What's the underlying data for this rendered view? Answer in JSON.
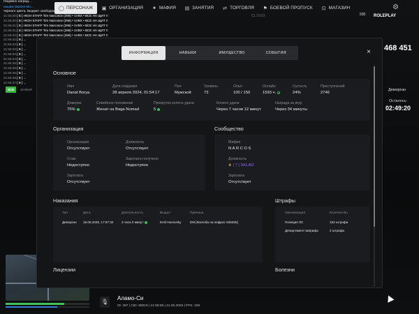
{
  "chat": {
    "header_line": "Недавно наград...",
    "highlight_line": "нашим Wanzet Mo...",
    "line3": "черного цвета. Бюджет свободный.",
    "messages": [
      {
        "time": "21:56:30",
        "text": "[ B ] HIGH STAFF Tim Narcosov (296) • 1VBX • ВСЕ НА ЩИТ !!"
      },
      {
        "time": "21:56:30",
        "text": "[ B ] HIGH STAFF Tim Narcosov (296) • 1VBX • ВСЕ НА ЩИТ !!"
      },
      {
        "time": "21:56:31",
        "text": "[ B ] HIGH STAFF Tim Narcosov (296) • 1VBX • ВСЕ НА ЩИТ !!"
      },
      {
        "time": "21:56:31",
        "text": "[ B ] HIGH STAFF Tim Narcosov (296) • 1VBX • ВСЕ НА ЩИТ !!"
      },
      {
        "time": "21:56:32",
        "text": "[ B ] HIGH STAFF Tim Narcosov (296) • 1VBX • ВСЕ НА ЩИТ !!"
      },
      {
        "time": "21:56:32",
        "text": "[ B ] ..."
      },
      {
        "time": "21:56:33",
        "text": "[ B ] ..."
      },
      {
        "time": "21:56:33",
        "text": "[ B ] ..."
      },
      {
        "time": "21:56:34",
        "text": "[ B ] ..."
      },
      {
        "time": "21:56:34",
        "text": "[ B ] ..."
      },
      {
        "time": "21:56:35",
        "text": "[ B ] ..."
      },
      {
        "time": "21:56:35",
        "text": "[ B ] ..."
      },
      {
        "time": "21:56:36",
        "text": "[ B ] ..."
      },
      {
        "time": "21:56:36",
        "text": "[ B ] ..."
      },
      {
        "time": "21:56:37",
        "text": "[ B ] ..."
      }
    ],
    "chip_all": "ВСЕ",
    "chip_other": "МАФИЯ"
  },
  "nav": {
    "items": [
      {
        "label": "ПЕРСОНАЖ",
        "icon": "person-icon",
        "active": true
      },
      {
        "label": "ОРГАНИЗАЦИЯ",
        "icon": "org-icon"
      },
      {
        "label": "МАФИЯ",
        "icon": "mafia-icon"
      },
      {
        "label": "ЗАНЯТИЯ",
        "icon": "tasks-icon"
      },
      {
        "label": "ТОРГОВЛЯ",
        "icon": "trade-icon"
      },
      {
        "label": "БОЕВОЙ ПРОПУСК",
        "icon": "battlepass-icon"
      },
      {
        "label": "МАГАЗИН",
        "icon": "shop-icon"
      }
    ]
  },
  "hud": {
    "cloud": "CLOUD",
    "badge": "530",
    "roleplay": "ROLEPLAY",
    "cash": "468 451",
    "demorgan": "Деморган",
    "remaining_label": "Осталось:",
    "timer": "02:49:20",
    "location": "Аламо-Си",
    "status_line": "ID: 287 | CID: 88010 | 21:58:59 | 21.06.2025 | FPS: 159"
  },
  "modal": {
    "tabs": [
      "ИНФОРМАЦИЯ",
      "НАВЫКИ",
      "ИМУЩЕСТВО",
      "СОБЫТИЯ"
    ],
    "close": "×",
    "basic": {
      "title": "Основное",
      "row1": [
        {
          "label": "Имя",
          "value": "Danat Borya"
        },
        {
          "label": "Дата создания",
          "value": "28 апреля 2024, 01:54:17"
        },
        {
          "label": "Пол",
          "value": "Мужской"
        },
        {
          "label": "Уровень",
          "value": "73"
        },
        {
          "label": "Опыт",
          "value": "100 / 150"
        },
        {
          "label": "Онлайн",
          "value": "1593 ч."
        },
        {
          "label": "Сытость",
          "value": "24%"
        },
        {
          "label": "Преступлений",
          "value": "2746"
        }
      ],
      "row2": [
        {
          "label": "Доверие",
          "value": "75%"
        },
        {
          "label": "Семейное положение",
          "value": "Женат на Baga Nomad"
        },
        {
          "label": "Прокруток колеса удачи",
          "value": "5"
        },
        {
          "label": "Колесо удачи",
          "value": "Через 7 часов 12 минут"
        },
        {
          "label": "Награда за игру",
          "value": "Через 34 минуты"
        }
      ]
    },
    "org": {
      "title": "Организация",
      "org_label": "Организация",
      "org_value": "Отсутствует",
      "pos_label": "Должность",
      "pos_value": "Отсутствует",
      "exp_label": "Стаж",
      "exp_value": "Недоступно",
      "salary_recv_label": "Зарплата получено",
      "salary_recv_value": "Недоступно",
      "salary_label": "Зарплата",
      "salary_value": "Отсутствует"
    },
    "community": {
      "title": "Сообщество",
      "mafia_label": "Мафия",
      "mafia_value": "NARCOS",
      "pos_label": "Должность",
      "pos_value": "| 7 | SKLAD",
      "salary_label": "Зарплата",
      "salary_value": "Отсутствует"
    },
    "punish": {
      "title": "Наказания",
      "headers": [
        "Тип",
        "Дата",
        "Длительность",
        "Выдал",
        "Причина"
      ],
      "rows": [
        [
          "Деморган",
          "15.06.2025, 17:57:32",
          "3 часа 0 минут",
          "Emil Hanovsky",
          "DM [Жалоба на нефрос 538255]"
        ]
      ]
    },
    "fines": {
      "title": "Штрафы",
      "headers": [
        "Организация",
        "Количество"
      ],
      "rows": [
        [
          "Полиция ЛС",
          "152 штрафа"
        ],
        [
          "Департамент Шерифа",
          "2 штрафа"
        ]
      ]
    },
    "licenses_title": "Лицензии",
    "diseases_title": "Болезни"
  }
}
